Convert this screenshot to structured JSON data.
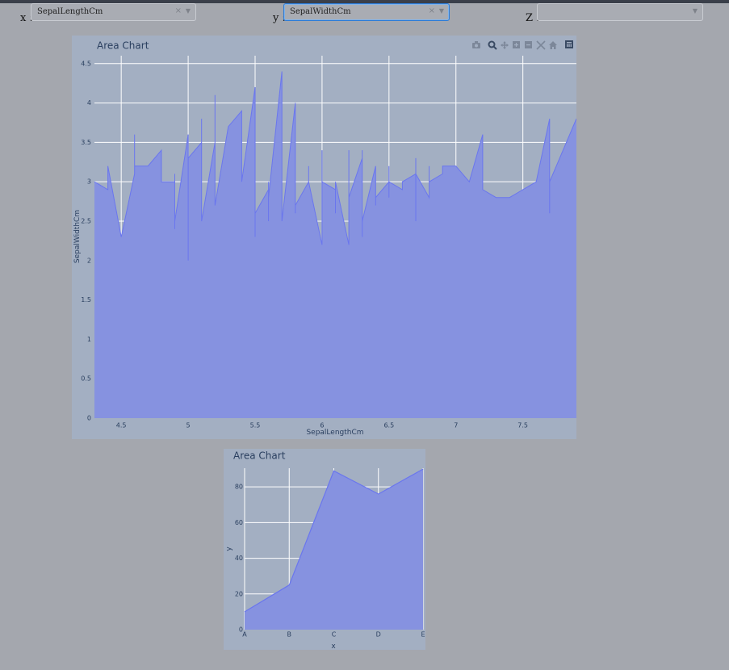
{
  "controls": {
    "x_label": "x :",
    "y_label": "y :",
    "z_label": "Z :",
    "x_value": "SepalLengthCm",
    "y_value": "SepalWidthCm",
    "z_value": ""
  },
  "modebar": [
    "camera-icon",
    "zoom-icon",
    "pan-icon",
    "zoom-in-icon",
    "zoom-out-icon",
    "autoscale-icon",
    "reset-axes-icon",
    "plotly-logo-icon"
  ],
  "colors": {
    "fill": "#8692e0",
    "line": "#6a76ee",
    "panel": "#a3afc2",
    "grid": "#ffffff"
  },
  "chart_data": [
    {
      "type": "area",
      "title": "Area Chart",
      "xlabel": "SepalLengthCm",
      "ylabel": "SepalWidthCm",
      "xlim": [
        4.3,
        7.9
      ],
      "ylim": [
        0,
        4.6
      ],
      "xticks": [
        "4.5",
        "5",
        "5.5",
        "6",
        "6.5",
        "7",
        "7.5"
      ],
      "yticks": [
        "0",
        "0.5",
        "1",
        "1.5",
        "2",
        "2.5",
        "3",
        "3.5",
        "4",
        "4.5"
      ],
      "x": [
        4.3,
        4.4,
        4.4,
        4.4,
        4.5,
        4.6,
        4.6,
        4.6,
        4.6,
        4.7,
        4.7,
        4.8,
        4.8,
        4.8,
        4.8,
        4.8,
        4.9,
        4.9,
        4.9,
        4.9,
        4.9,
        4.9,
        5.0,
        5.0,
        5.0,
        5.0,
        5.0,
        5.0,
        5.0,
        5.0,
        5.0,
        5.0,
        5.1,
        5.1,
        5.1,
        5.1,
        5.1,
        5.1,
        5.1,
        5.1,
        5.1,
        5.2,
        5.2,
        5.2,
        5.2,
        5.3,
        5.4,
        5.4,
        5.4,
        5.4,
        5.4,
        5.4,
        5.5,
        5.5,
        5.5,
        5.5,
        5.5,
        5.5,
        5.5,
        5.6,
        5.6,
        5.6,
        5.6,
        5.6,
        5.6,
        5.7,
        5.7,
        5.7,
        5.7,
        5.7,
        5.7,
        5.7,
        5.7,
        5.8,
        5.8,
        5.8,
        5.8,
        5.8,
        5.8,
        5.8,
        5.9,
        5.9,
        5.9,
        6.0,
        6.0,
        6.0,
        6.0,
        6.0,
        6.0,
        6.1,
        6.1,
        6.1,
        6.1,
        6.1,
        6.1,
        6.2,
        6.2,
        6.2,
        6.2,
        6.3,
        6.3,
        6.3,
        6.3,
        6.3,
        6.3,
        6.3,
        6.3,
        6.3,
        6.4,
        6.4,
        6.4,
        6.4,
        6.4,
        6.4,
        6.4,
        6.5,
        6.5,
        6.5,
        6.5,
        6.5,
        6.6,
        6.6,
        6.7,
        6.7,
        6.7,
        6.7,
        6.7,
        6.7,
        6.7,
        6.7,
        6.8,
        6.8,
        6.8,
        6.9,
        6.9,
        6.9,
        6.9,
        7.0,
        7.1,
        7.2,
        7.2,
        7.2,
        7.3,
        7.4,
        7.6,
        7.7,
        7.7,
        7.7,
        7.7,
        7.9
      ],
      "y": [
        3.0,
        2.9,
        3.0,
        3.2,
        2.3,
        3.1,
        3.4,
        3.6,
        3.2,
        3.2,
        3.2,
        3.4,
        3.0,
        3.4,
        3.1,
        3.0,
        3.0,
        3.1,
        3.1,
        3.1,
        2.4,
        2.5,
        3.6,
        3.4,
        3.0,
        3.4,
        3.2,
        3.5,
        3.5,
        2.3,
        2.0,
        3.3,
        3.5,
        3.5,
        3.8,
        3.8,
        3.7,
        3.3,
        3.4,
        3.8,
        2.5,
        3.5,
        3.4,
        4.1,
        2.7,
        3.7,
        3.9,
        3.7,
        3.9,
        3.4,
        3.4,
        3.0,
        4.2,
        3.5,
        2.3,
        2.4,
        2.4,
        2.5,
        2.6,
        2.9,
        3.0,
        2.5,
        2.7,
        2.8,
        2.8,
        4.4,
        3.8,
        3.8,
        2.8,
        2.6,
        2.9,
        3.0,
        2.5,
        4.0,
        2.7,
        2.6,
        2.7,
        2.8,
        2.7,
        2.7,
        3.0,
        3.2,
        3.0,
        2.2,
        2.2,
        2.9,
        2.7,
        3.4,
        3.0,
        2.9,
        3.0,
        2.8,
        2.8,
        2.6,
        3.0,
        2.2,
        2.9,
        3.4,
        2.8,
        3.3,
        2.9,
        2.5,
        2.3,
        2.5,
        2.7,
        2.8,
        3.4,
        2.5,
        3.2,
        2.9,
        3.2,
        2.7,
        2.8,
        3.1,
        2.8,
        3.0,
        2.8,
        3.0,
        3.2,
        3.0,
        2.9,
        3.0,
        3.1,
        3.0,
        2.5,
        3.1,
        3.3,
        3.0,
        3.3,
        3.1,
        2.8,
        3.2,
        3.0,
        3.1,
        3.1,
        3.1,
        3.2,
        3.2,
        3.0,
        3.6,
        3.2,
        2.9,
        2.8,
        2.8,
        3.0,
        3.8,
        2.6,
        2.8,
        3.0,
        3.8
      ]
    },
    {
      "type": "area",
      "title": "Area Chart",
      "xlabel": "x",
      "ylabel": "y",
      "categories": [
        "A",
        "B",
        "C",
        "D",
        "E"
      ],
      "values": [
        10,
        25,
        89,
        76,
        90
      ],
      "ylim": [
        0,
        95
      ],
      "yticks": [
        "0",
        "20",
        "40",
        "60",
        "80"
      ]
    }
  ]
}
